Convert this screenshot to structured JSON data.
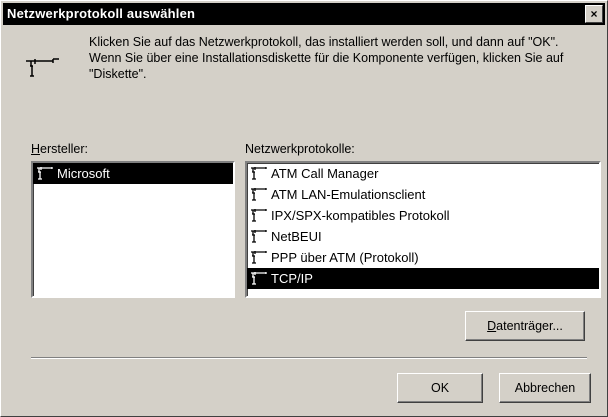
{
  "window": {
    "title": "Netzwerkprotokoll auswählen",
    "close_glyph": "×"
  },
  "intro_text": "Klicken Sie auf das Netzwerkprotokoll, das installiert werden soll, und dann auf \"OK\". Wenn Sie über eine Installationsdiskette für die Komponente verfügen, klicken Sie auf \"Diskette\".",
  "manufacturers": {
    "label_mnemonic": "H",
    "label_rest": "ersteller:",
    "items": [
      "Microsoft"
    ],
    "selected_index": 0
  },
  "protocols": {
    "label": "Netzwerkprotokolle:",
    "items": [
      "ATM Call Manager",
      "ATM LAN-Emulationsclient",
      "IPX/SPX-kompatibles Protokoll",
      "NetBEUI",
      "PPP über ATM (Protokoll)",
      "TCP/IP"
    ],
    "selected_index": 5
  },
  "buttons": {
    "disk_mnemonic": "D",
    "disk_rest": "atenträger...",
    "ok": "OK",
    "cancel": "Abbrechen"
  },
  "icons": {
    "protocol": "network-protocol-icon",
    "close": "close-icon"
  },
  "colors": {
    "face": "#d4d0c8",
    "titlebar": "#000000",
    "selection": "#000000",
    "list_bg": "#ffffff"
  }
}
